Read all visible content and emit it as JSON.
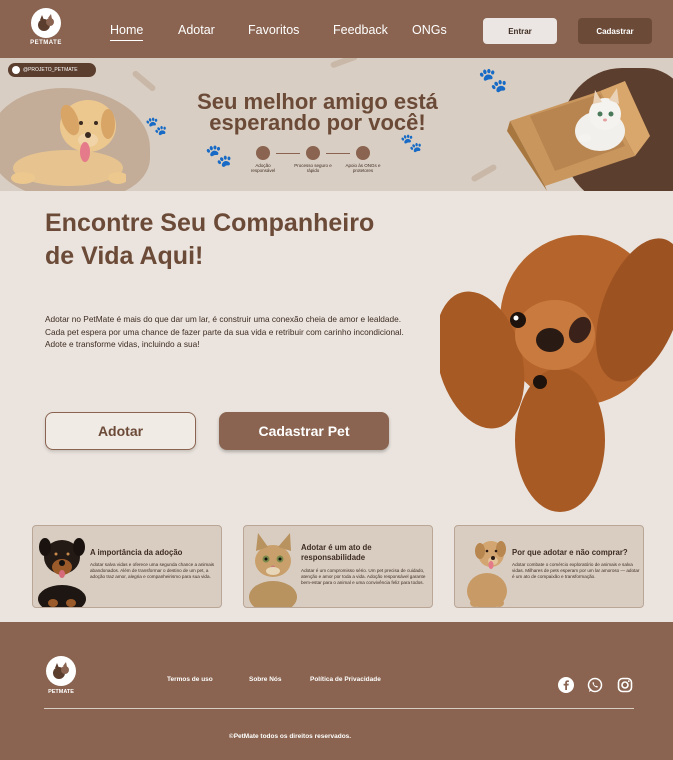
{
  "nav": {
    "brand": "PETMATE",
    "links": [
      "Home",
      "Adotar",
      "Favoritos",
      "Feedback",
      "ONGs"
    ],
    "entrar": "Entrar",
    "cadastrar": "Cadastrar"
  },
  "banner": {
    "handle": "@PROJETO_PETMATE",
    "title": "Seu melhor amigo está esperando por você!",
    "steps": [
      "Adoção responsável",
      "Processo seguro e rápido",
      "Apoio às ONGs e protetores"
    ]
  },
  "hero": {
    "title": "Encontre Seu Companheiro de Vida Aqui!",
    "text": "Adotar no PetMate é mais do que dar um lar, é construir uma conexão cheia de amor e lealdade. Cada pet espera por uma chance de fazer parte da sua vida e retribuir com carinho incondicional. Adote e transforme vidas, incluindo a sua!",
    "btn_adotar": "Adotar",
    "btn_pet": "Cadastrar Pet"
  },
  "cards": [
    {
      "title": "A importância da adoção",
      "text": "Adotar salva vidas e oferece uma segunda chance a animais abandonados. Além de transformar o destino de um pet, a adoção traz amor, alegria e companheirismo para sua vida."
    },
    {
      "title": "Adotar é um ato de responsabilidade",
      "text": "Adotar é um compromisso sério. Um pet precisa de cuidado, atenção e amor por toda a vida. Adoção responsável garante bem-estar para o animal e uma convivência feliz para todos."
    },
    {
      "title": "Por que adotar e não comprar?",
      "text": "Adotar combate o comércio exploratório de animais e salva vidas. Milhares de pets esperam por um lar amoroso — adotar é um ato de compaixão e transformação."
    }
  ],
  "footer": {
    "brand": "PETMATE",
    "links": [
      "Termos de uso",
      "Sobre Nós",
      "Política de Privacidade"
    ],
    "copyright": "©PetMate todos os direitos reservados."
  },
  "colors": {
    "primary": "#8a6450",
    "dark": "#6b4a37",
    "background": "#ebe4de"
  }
}
